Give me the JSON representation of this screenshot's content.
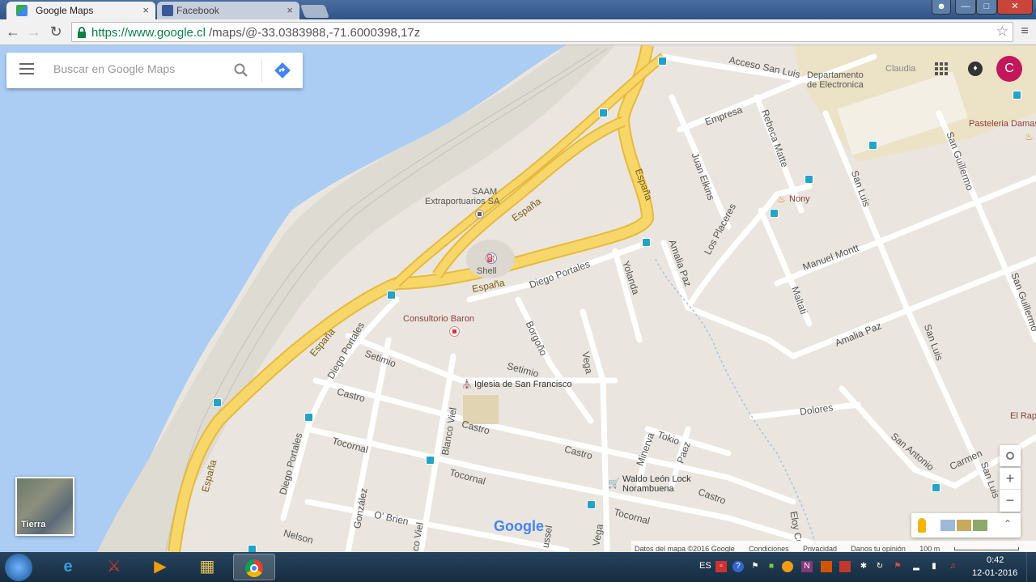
{
  "browser": {
    "tabs": [
      {
        "title": "Google Maps",
        "active": true
      },
      {
        "title": "Facebook",
        "active": false
      }
    ],
    "url_secure": "https://www.google.cl",
    "url_path": "/maps/@-33.0383988,-71.6000398,17z",
    "close_glyph": "×"
  },
  "search": {
    "placeholder": "Buscar en Google Maps"
  },
  "account": {
    "avatar_letter": "C"
  },
  "map_labels": {
    "acceso_san_luis": "Acceso San Luis",
    "claudia": "Claudia",
    "departamento_1": "Departamento",
    "departamento_2": "de Electronica",
    "empresa": "Empresa",
    "rebeca_matte": "Rebeca Matte",
    "juan_elkins": "Juan Elkins",
    "san_guillermo": "San Guillermo",
    "san_guillermo_2": "San Guillermo",
    "pasteleria": "Pasteleria Damasc",
    "saam_1": "SAAM",
    "saam_2": "Extraportuarios SA",
    "espana": "España",
    "nony": "Nony",
    "san_luis": "San Luis",
    "san_luis_2": "San Luis",
    "san_luis_3": "San Luis",
    "los_placeres": "Los Placeres",
    "shell": "Shell",
    "amalia_paz": "Amalia Paz",
    "amalia_paz_2": "Amalia Paz",
    "manuel_montt": "Manuel Montt",
    "diego_portales": "Diego Portales",
    "diego_portales_2": "Diego Portales",
    "diego_portales_3": "Diego Portales",
    "yolanda": "Yolanda",
    "maltati": "Maltati",
    "consultorio": "Consultorio Baron",
    "borgono": "Borgoño",
    "setimio": "Setimio",
    "setimio_2": "Setimio",
    "vega": "Vega",
    "vega_2": "Vega",
    "iglesia": "Iglesia de San Francisco",
    "castro": "Castro",
    "castro_2": "Castro",
    "castro_3": "Castro",
    "castro_4": "Castro",
    "dolores": "Dolores",
    "el_rapi": "El Rapi",
    "blanco_viel": "Blanco Viel",
    "tocornal": "Tocornal",
    "tocornal_2": "Tocornal",
    "tocornal_3": "Tocornal",
    "minerva": "Minerva",
    "tokio": "Tokio",
    "paez": "Paez",
    "san_antonio": "San Antonio",
    "carmen": "Carmen",
    "waldo_1": "Waldo León Lock",
    "waldo_2": "Norambuena",
    "gonzalez": "González",
    "obrien": "O' Brien",
    "nelson": "Nelson",
    "co_viel": "co Viel",
    "ussel": "ussel",
    "eloy": "Eloy Cr"
  },
  "map_ui": {
    "layer_label": "Tierra",
    "google_logo": "Google",
    "zoom_in": "+",
    "zoom_out": "−",
    "footer": {
      "data": "Datos del mapa ©2016 Google",
      "terms": "Condiciones",
      "privacy": "Privacidad",
      "feedback": "Danos tu opinión",
      "scale": "100 m"
    }
  },
  "taskbar": {
    "language": "ES",
    "time": "0:42",
    "date": "12-01-2016"
  },
  "colors": {
    "water": "#abcdf4",
    "highway": "#f7d76a",
    "highway_edge": "#e8b93b",
    "road": "#ffffff",
    "land": "#eae6df",
    "bus_stop": "#25a3c7",
    "avatar": "#c2185b"
  }
}
